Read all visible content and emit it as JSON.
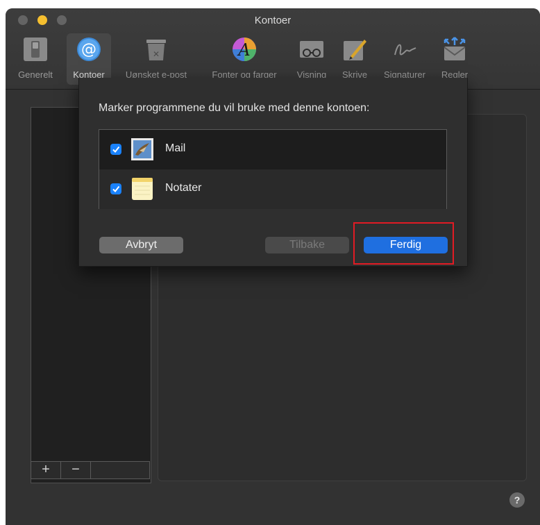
{
  "window": {
    "title": "Kontoer"
  },
  "toolbar": {
    "items": [
      {
        "label": "Generelt",
        "icon": "switch-icon",
        "selected": false
      },
      {
        "label": "Kontoer",
        "icon": "at-icon",
        "selected": true
      },
      {
        "label": "Uønsket e-post",
        "icon": "trash-icon",
        "selected": false
      },
      {
        "label": "Fonter og farger",
        "icon": "font-color-icon",
        "selected": false
      },
      {
        "label": "Visning",
        "icon": "glasses-icon",
        "selected": false
      },
      {
        "label": "Skrive",
        "icon": "pen-icon",
        "selected": false
      },
      {
        "label": "Signaturer",
        "icon": "signature-icon",
        "selected": false
      },
      {
        "label": "Regler",
        "icon": "rules-icon",
        "selected": false
      }
    ]
  },
  "account_buttons": {
    "add": "+",
    "remove": "−"
  },
  "sheet": {
    "title": "Marker programmene du vil bruke med denne kontoen:",
    "apps": [
      {
        "name": "Mail",
        "checked": true,
        "icon": "mail-stamp-icon"
      },
      {
        "name": "Notater",
        "checked": true,
        "icon": "notes-icon"
      }
    ],
    "buttons": {
      "cancel": "Avbryt",
      "back": "Tilbake",
      "done": "Ferdig"
    }
  },
  "help": "?",
  "colors": {
    "accent": "#1f6fe0",
    "checkbox": "#1a82fb",
    "highlight": "#e21b24"
  }
}
